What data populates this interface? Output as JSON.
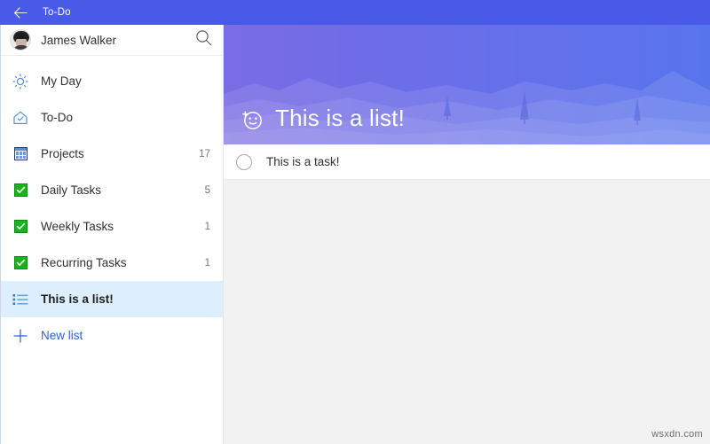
{
  "window": {
    "back_icon": "back-arrow-icon",
    "title": "To-Do",
    "titlebar_color": "#4a5ae8"
  },
  "sidebar": {
    "user": {
      "name": "James Walker",
      "avatar_icon": "user-avatar-photo"
    },
    "search": {
      "icon": "search-icon"
    },
    "items": [
      {
        "label": "My Day",
        "icon": "sun-icon",
        "count": ""
      },
      {
        "label": "To-Do",
        "icon": "home-check-icon",
        "count": ""
      },
      {
        "label": "Projects",
        "icon": "grid-table-icon",
        "count": "17"
      },
      {
        "label": "Daily Tasks",
        "icon": "green-check-icon",
        "count": "5"
      },
      {
        "label": "Weekly Tasks",
        "icon": "green-check-icon",
        "count": "1"
      },
      {
        "label": "Recurring Tasks",
        "icon": "green-check-icon",
        "count": "1"
      },
      {
        "label": "This is a list!",
        "icon": "bullet-list-icon",
        "count": "",
        "selected": true
      }
    ],
    "new_list": {
      "label": "New list",
      "icon": "plus-icon",
      "color": "#2b5fd9"
    }
  },
  "content": {
    "hero": {
      "title": "This is a list!",
      "emoji_icon": "add-emoji-smiley-icon",
      "gradient_from": "#7a6ce4",
      "gradient_to": "#5874ec"
    },
    "tasks": [
      {
        "label": "This is a task!",
        "checked": false,
        "check_icon": "circle-unchecked-icon"
      }
    ]
  },
  "watermark": "wsxdn.com"
}
